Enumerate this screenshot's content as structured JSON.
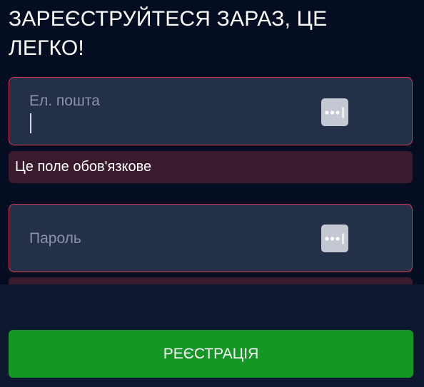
{
  "form": {
    "title": "ЗАРЕЄСТРУЙТЕСЯ ЗАРАЗ, ЦЕ ЛЕГКО!",
    "email": {
      "placeholder": "Ел. пошта",
      "value": "",
      "icon": "password-manager-icon",
      "error": "Це поле обов'язкове"
    },
    "password": {
      "placeholder": "Пароль",
      "value": "",
      "icon": "password-manager-icon"
    },
    "submit_label": "РЕЄСТРАЦІЯ"
  },
  "colors": {
    "background": "#040d22",
    "field_background": "#243048",
    "field_border_error": "#e0374e",
    "error_background": "#3a1a2d",
    "submit_background": "#159726"
  }
}
